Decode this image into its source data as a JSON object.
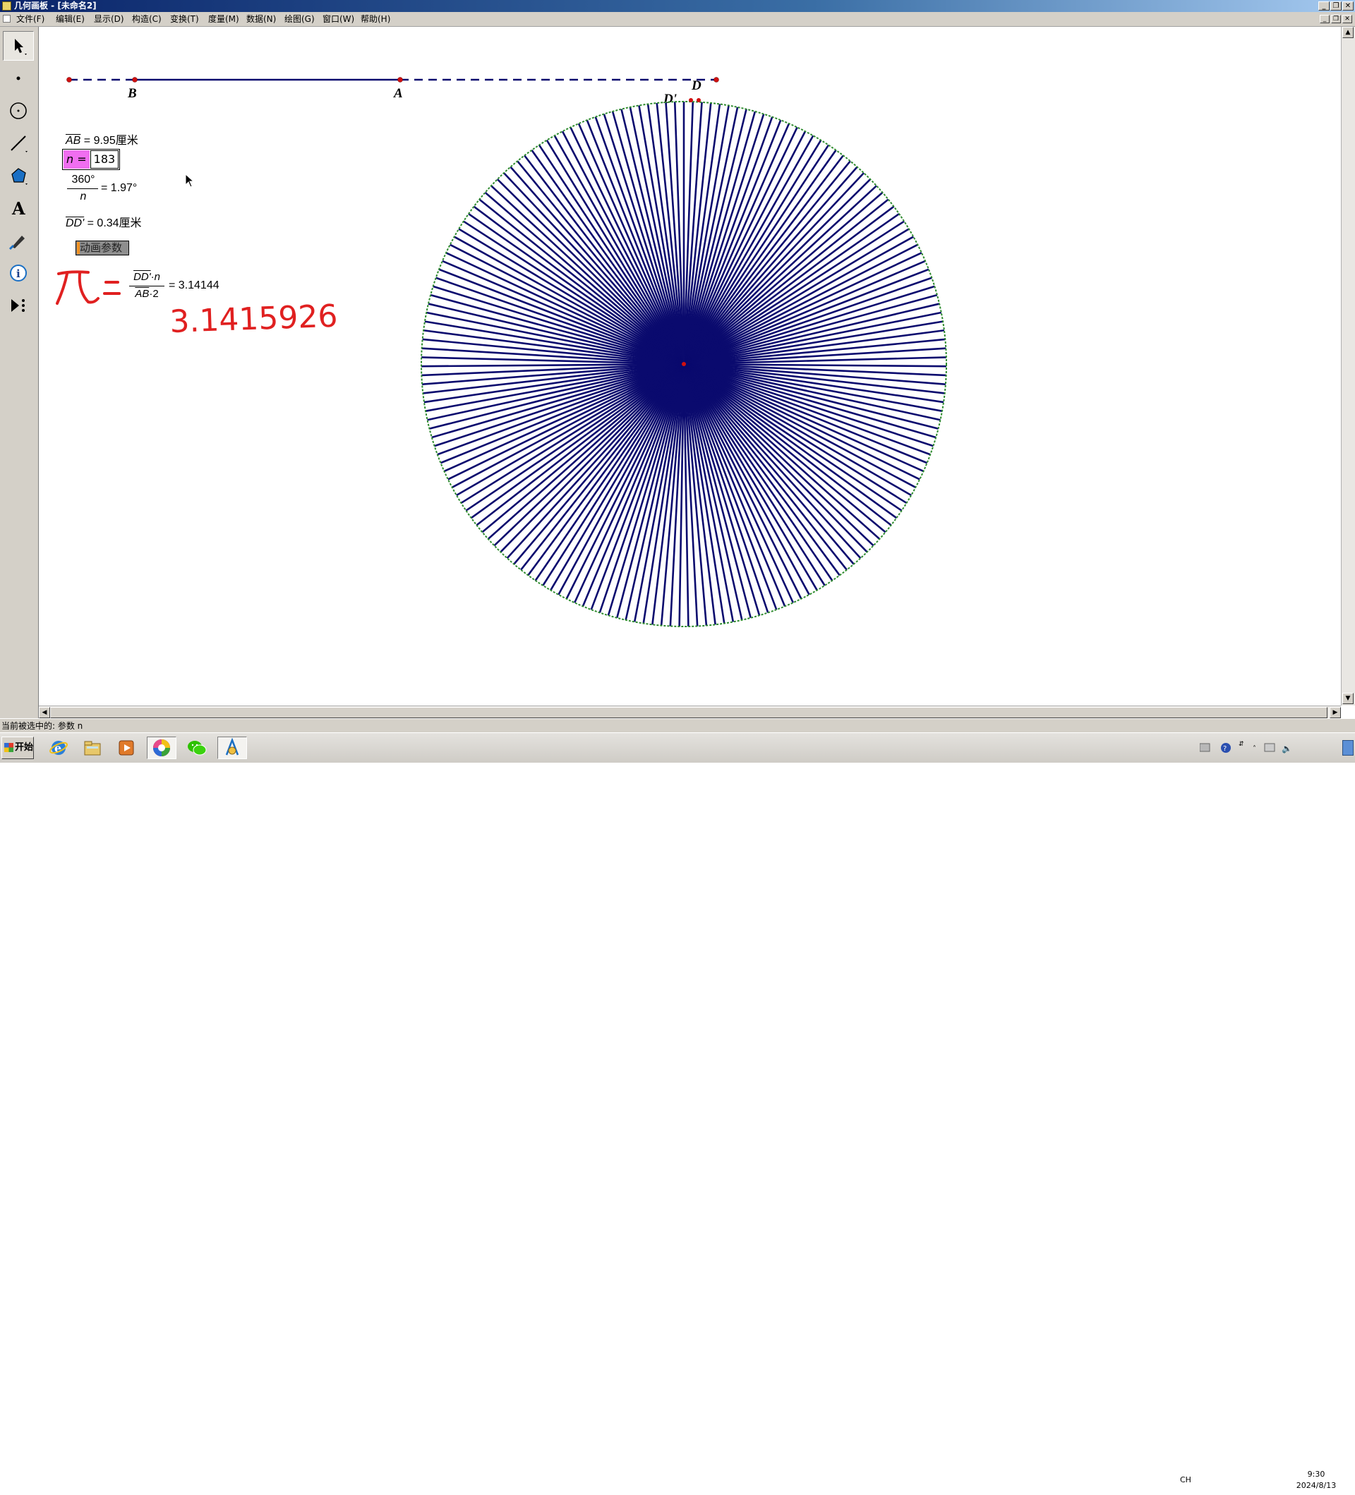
{
  "window": {
    "title": "几何画板 - [未命名2]",
    "controls": [
      "_",
      "❐",
      "✕"
    ]
  },
  "menu": {
    "items": [
      "文件(F)",
      "编辑(E)",
      "显示(D)",
      "构造(C)",
      "变换(T)",
      "度量(M)",
      "数据(N)",
      "绘图(G)",
      "窗口(W)",
      "帮助(H)"
    ]
  },
  "toolbox": {
    "tools": [
      "arrow-tool-icon",
      "point-tool-icon",
      "compass-tool-icon",
      "straightedge-tool-icon",
      "polygon-tool-icon",
      "text-tool-icon",
      "marker-tool-icon",
      "information-tool-icon",
      "custom-tool-icon"
    ]
  },
  "sketch": {
    "segment_labels": {
      "B": "B",
      "A": "A",
      "D": "D",
      "D_prime": "D'"
    },
    "measure_ab": {
      "name": "AB",
      "value": "= 9.95厘米"
    },
    "parameter": {
      "label": "n =",
      "value": "183"
    },
    "angle_calc": {
      "numerator": "360°",
      "denominator": "n",
      "value": "= 1.97°"
    },
    "measure_dd": {
      "name": "DD'",
      "value": "= 0.34厘米"
    },
    "animate_button": "动画参数",
    "pi_calc": {
      "numerator_a": "DD'",
      "numerator_b": "·n",
      "denominator_a": "AB",
      "denominator_b": "·2",
      "value": "= 3.14144"
    },
    "handwriting": {
      "pi_symbol": "π =",
      "digits": "3.1415926",
      "color": "#e02020"
    },
    "spoke_count": 183,
    "spoke_color": "#0a0a6e",
    "circle_color": "#2e8b2e",
    "point_color": "#d01010"
  },
  "statusbar": {
    "text": "当前被选中的: 参数 n"
  },
  "taskbar": {
    "start_label": "开始",
    "apps": [
      "ie-icon",
      "explorer-icon",
      "media-player-icon",
      "browser-icon",
      "wechat-icon",
      "sketchpad-icon"
    ],
    "tray": {
      "lang": "CH",
      "time": "9:30",
      "date": "2024/8/13"
    }
  }
}
